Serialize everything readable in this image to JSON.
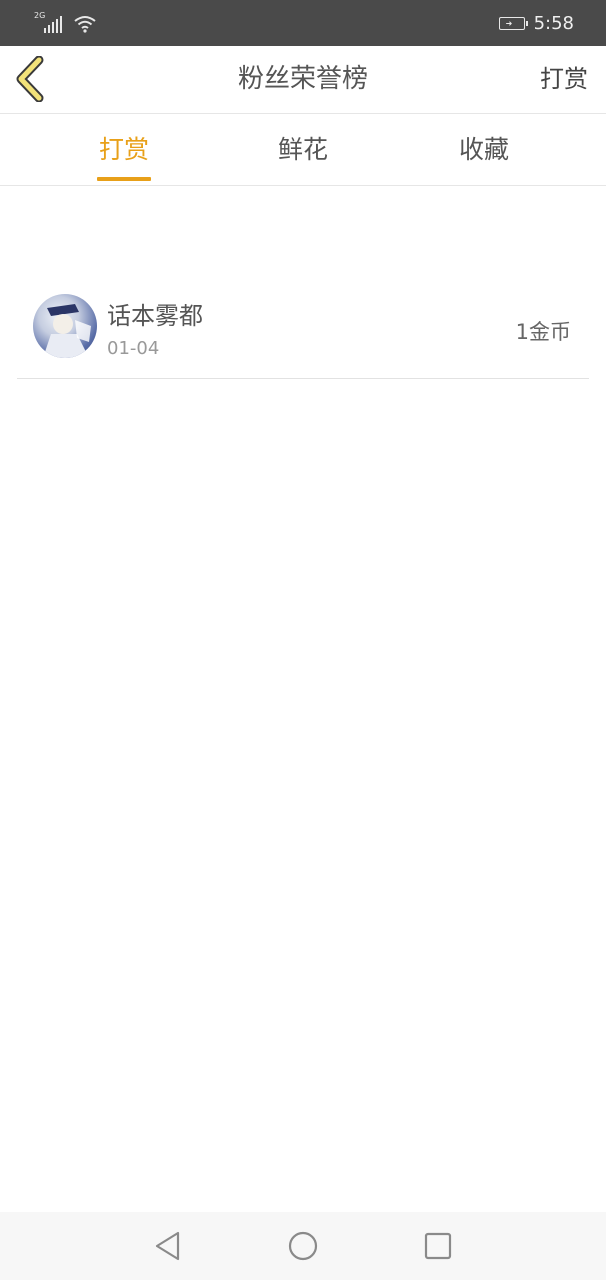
{
  "status_bar": {
    "network": "2G",
    "time": "5:58",
    "icons": [
      "signal-icon",
      "wifi-icon",
      "battery-charging-icon"
    ]
  },
  "header": {
    "title": "粉丝荣誉榜",
    "action_label": "打赏",
    "back_icon": "chevron-left-icon"
  },
  "tabs": [
    {
      "label": "打赏",
      "active": true
    },
    {
      "label": "鲜花",
      "active": false
    },
    {
      "label": "收藏",
      "active": false
    }
  ],
  "list": [
    {
      "name": "话本雾都",
      "date": "01-04",
      "amount": "1金币"
    }
  ],
  "nav_bar": {
    "icons": [
      "back-triangle-icon",
      "home-circle-icon",
      "recent-square-icon"
    ]
  },
  "colors": {
    "accent": "#e8a019",
    "status_bar_bg": "#4a4a4a",
    "back_icon_fill": "#f2e27a",
    "text_primary": "#555555",
    "text_secondary": "#999999"
  }
}
